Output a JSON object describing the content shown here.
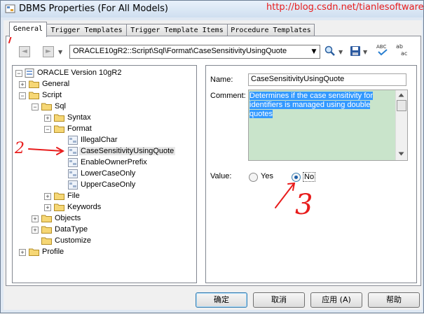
{
  "window": {
    "title": "DBMS Properties (For All Models)",
    "watermark": "http://blog.csdn.net/tianlesoftware"
  },
  "tabs": [
    {
      "label": "General",
      "active": true
    },
    {
      "label": "Trigger Templates",
      "active": false
    },
    {
      "label": "Trigger Template Items",
      "active": false
    },
    {
      "label": "Procedure Templates",
      "active": false
    }
  ],
  "toolbar": {
    "path": "ORACLE10gR2::Script\\Sql\\Format\\CaseSensitivityUsingQuote",
    "icons": [
      "back-icon",
      "forward-icon",
      "find-icon",
      "save-icon",
      "spell-check-icon",
      "text-case-icon"
    ]
  },
  "tree": {
    "root": "ORACLE Version 10gR2",
    "items": [
      {
        "label": "General"
      },
      {
        "label": "Script"
      },
      {
        "label": "Sql"
      },
      {
        "label": "Syntax"
      },
      {
        "label": "Format"
      },
      {
        "label": "IllegalChar"
      },
      {
        "label": "CaseSensitivityUsingQuote",
        "selected": true
      },
      {
        "label": "EnableOwnerPrefix"
      },
      {
        "label": "LowerCaseOnly"
      },
      {
        "label": "UpperCaseOnly"
      },
      {
        "label": "File"
      },
      {
        "label": "Keywords"
      },
      {
        "label": "Objects"
      },
      {
        "label": "DataType"
      },
      {
        "label": "Customize"
      },
      {
        "label": "Profile"
      }
    ]
  },
  "details": {
    "name_label": "Name:",
    "name_value": "CaseSensitivityUsingQuote",
    "comment_label": "Comment:",
    "comment_value": "Determines if the case sensitivity for identifiers is managed using double quotes",
    "value_label": "Value:",
    "options": [
      {
        "label": "Yes",
        "checked": false
      },
      {
        "label": "No",
        "checked": true
      }
    ]
  },
  "buttons": {
    "ok": "确定",
    "cancel": "取消",
    "apply": "应用 (A)",
    "help": "帮助"
  },
  "annotations": [
    "1",
    "2",
    "3"
  ],
  "colors": {
    "annotation": "#e81d1d",
    "comment_bg": "#c9e4cb",
    "selection": "#3399ff"
  }
}
